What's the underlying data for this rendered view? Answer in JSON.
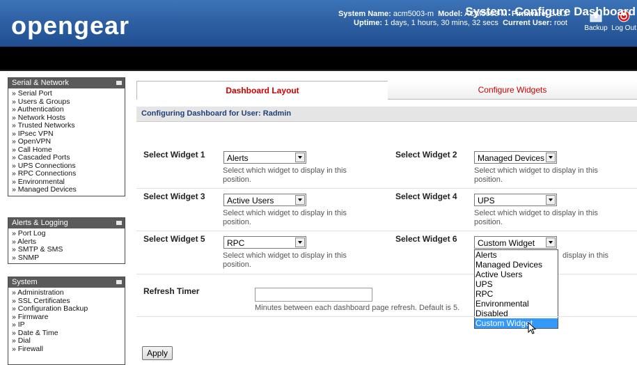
{
  "header": {
    "logo": "opengear",
    "system_name_label": "System Name:",
    "system_name": "acm5003-m",
    "model_label": "Model:",
    "model": "ACM5003-M",
    "firmware_label": "Firmware:",
    "firmware": "3.3.2",
    "uptime_label": "Uptime:",
    "uptime": "1 days, 1 hours, 30 mins, 32 secs",
    "current_user_label": "Current User:",
    "current_user": "root",
    "backup_label": "Backup",
    "logout_label": "Log Out"
  },
  "page_title": "System: Configure Dashboard",
  "sidebar": {
    "serial_network": {
      "title": "Serial & Network",
      "items": [
        "» Serial Port",
        "» Users & Groups",
        "» Authentication",
        "» Network Hosts",
        "» Trusted Networks",
        "» IPsec VPN",
        "» OpenVPN",
        "» Call Home",
        "» Cascaded Ports",
        "» UPS Connections",
        "» RPC Connections",
        "» Environmental",
        "» Managed Devices"
      ]
    },
    "alerts_logging": {
      "title": "Alerts & Logging",
      "items": [
        "» Port Log",
        "» Alerts",
        "» SMTP & SMS",
        "» SNMP"
      ]
    },
    "system": {
      "title": "System",
      "items": [
        "» Administration",
        "» SSL Certificates",
        "» Configuration Backup",
        "» Firmware",
        "» IP",
        "» Date & Time",
        "» Dial",
        "» Firewall"
      ]
    }
  },
  "tabs": [
    "Dashboard Layout",
    "Configure Widgets"
  ],
  "configuring_text": "Configuring Dashboard for User: Radmin",
  "widgets": [
    {
      "label": "Select Widget 1",
      "value": "Alerts",
      "hint": "Select which widget to display in this position."
    },
    {
      "label": "Select Widget 2",
      "value": "Managed Devices",
      "hint": "Select which widget to display in this position."
    },
    {
      "label": "Select Widget 3",
      "value": "Active Users",
      "hint": "Select which widget to display in this position."
    },
    {
      "label": "Select Widget 4",
      "value": "UPS",
      "hint": "Select which widget to display in this position."
    },
    {
      "label": "Select Widget 5",
      "value": "RPC",
      "hint": "Select which widget to display in this position."
    },
    {
      "label": "Select Widget 6",
      "value": "Custom Widget",
      "hint": "display in this"
    }
  ],
  "dropdown_options": [
    "Alerts",
    "Managed Devices",
    "Active Users",
    "UPS",
    "RPC",
    "Environmental",
    "Disabled",
    "Custom Widget"
  ],
  "dropdown_highlighted": "Custom Widget",
  "refresh": {
    "label": "Refresh Timer",
    "value": "",
    "hint": "Minutes between each dashboard page refresh. Default is 5."
  },
  "apply_label": "Apply",
  "colors": {
    "header_blue": "#2b5d9f",
    "tab_red": "#cc0000",
    "highlight": "#3399ff"
  }
}
